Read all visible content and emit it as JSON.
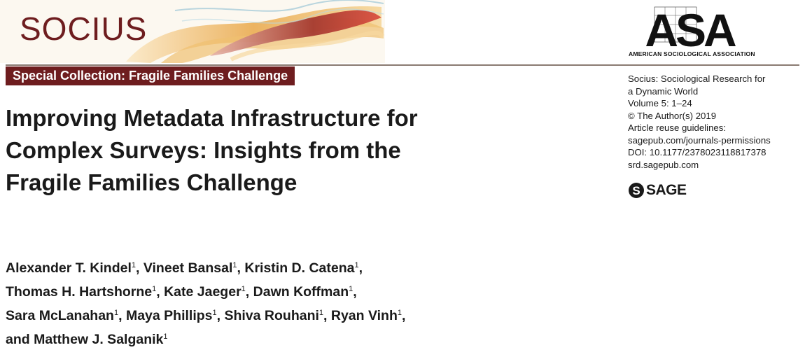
{
  "journal": {
    "name": "SOCIUS",
    "collection": "Special Collection: Fragile Families Challenge"
  },
  "asa": {
    "letters": "ASA",
    "caption": "AMERICAN SOCIOLOGICAL ASSOCIATION"
  },
  "meta_lines": [
    "Socius: Sociological Research for",
    "a Dynamic World",
    "Volume 5: 1–24",
    "© The Author(s) 2019",
    "Article reuse guidelines:",
    "sagepub.com/journals-permissions",
    "DOI: 10.1177/2378023118817378",
    "srd.sagepub.com"
  ],
  "publisher": {
    "name": "SAGE"
  },
  "title_lines": [
    "Improving Metadata Infrastructure for",
    "Complex Surveys: Insights from the",
    "Fragile Families Challenge"
  ],
  "authors": [
    [
      {
        "name": "Alexander T. Kindel",
        "aff": "1",
        "sep": ","
      },
      {
        "name": "Vineet Bansal",
        "aff": "1",
        "sep": ","
      },
      {
        "name": "Kristin D. Catena",
        "aff": "1",
        "sep": ","
      }
    ],
    [
      {
        "name": "Thomas H. Hartshorne",
        "aff": "1",
        "sep": ","
      },
      {
        "name": "Kate Jaeger",
        "aff": "1",
        "sep": ","
      },
      {
        "name": "Dawn Koffman",
        "aff": "1",
        "sep": ","
      }
    ],
    [
      {
        "name": "Sara McLanahan",
        "aff": "1",
        "sep": ","
      },
      {
        "name": "Maya Phillips",
        "aff": "1",
        "sep": ","
      },
      {
        "name": "Shiva Rouhani",
        "aff": "1",
        "sep": ","
      },
      {
        "name": "Ryan Vinh",
        "aff": "1",
        "sep": ","
      }
    ],
    [
      {
        "name": "and Matthew J. Salganik",
        "aff": "1",
        "sep": ""
      }
    ]
  ],
  "colors": {
    "brand": "#6e1d1f",
    "ribbon_orange": "#e8a040",
    "ribbon_light": "#f3cf8a"
  }
}
